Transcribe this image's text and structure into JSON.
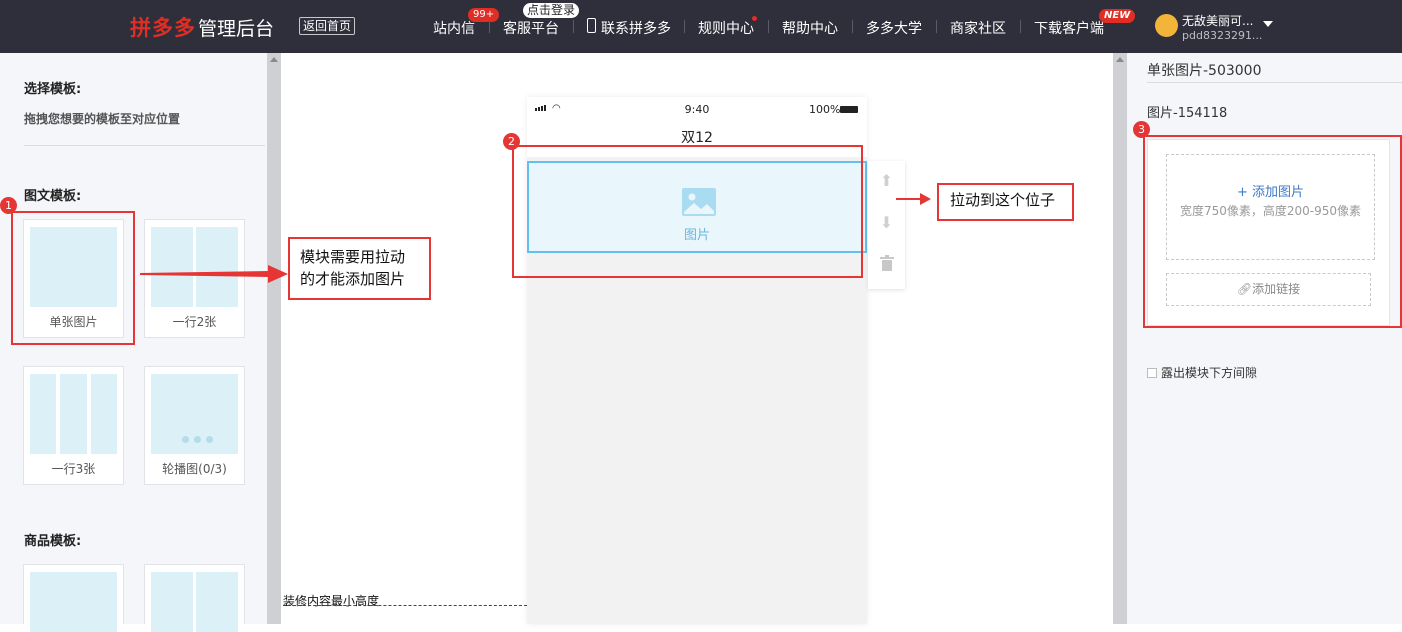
{
  "header": {
    "logo_brand": "拼多多",
    "logo_text": "管理后台",
    "back_home": "返回首页",
    "nav": {
      "messages": "站内信",
      "messages_badge": "99+",
      "service": "客服平台",
      "service_badge": "点击登录",
      "contact": "联系拼多多",
      "rules": "规则中心",
      "help": "帮助中心",
      "university": "多多大学",
      "community": "商家社区",
      "download": "下载客户端",
      "download_badge": "NEW"
    },
    "user": {
      "name": "无敌美丽可...",
      "id": "pdd8323291..."
    }
  },
  "left_panel": {
    "choose_title": "选择模板:",
    "choose_hint": "拖拽您想要的模板至对应位置",
    "image_text_title": "图文模板:",
    "templates": [
      {
        "label": "单张图片"
      },
      {
        "label": "一行2张"
      },
      {
        "label": "一行3张"
      },
      {
        "label": "轮播图(0/3)"
      }
    ],
    "goods_title": "商品模板:"
  },
  "canvas": {
    "status_time": "9:40",
    "status_battery": "100%",
    "page_title": "双12",
    "image_module_label": "图片",
    "min_height_label": "装修内容最小高度"
  },
  "annotations": {
    "num1": "1",
    "num2": "2",
    "num3": "3",
    "note_drag": "模块需要用拉动的才能添加图片",
    "note_position": "拉动到这个位子"
  },
  "right_panel": {
    "title": "单张图片-503000",
    "image_name": "图片-154118",
    "add_image": "+ 添加图片",
    "add_image_tip": "宽度750像素，高度200-950像素",
    "add_link": "添加链接",
    "gap_label": "露出模块下方间隙"
  },
  "colors": {
    "accent_red": "#e02e24",
    "annotation_red": "#e63535",
    "header_bg": "#2e2f3b",
    "module_border": "#61c0ee",
    "link_blue": "#3e79c7"
  }
}
